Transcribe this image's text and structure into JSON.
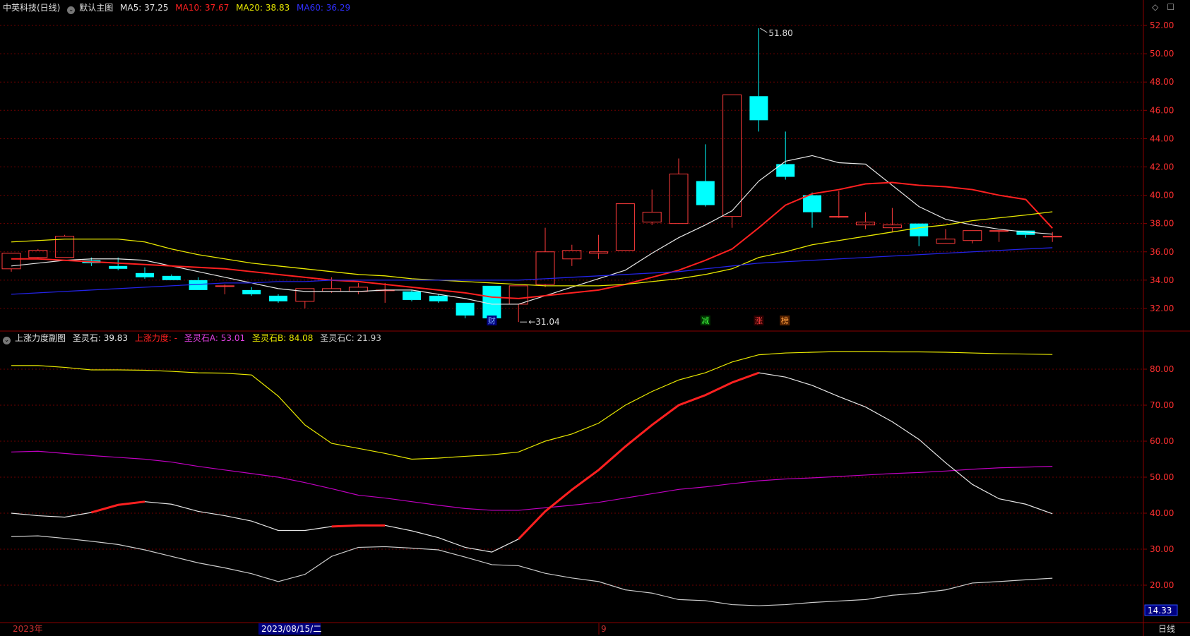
{
  "header": {
    "stock_name": "中英科技(日线)",
    "main_chart_label": "默认主图",
    "ma5": "MA5: 37.25",
    "ma10": "MA10: 37.67",
    "ma20": "MA20: 38.83",
    "ma60": "MA60: 36.29",
    "corner_icons": [
      "◇",
      "☐"
    ]
  },
  "sub_header": {
    "title": "上涨力度副图",
    "sls": "圣灵石: 39.83",
    "szld": "上涨力度: -",
    "slsa": "圣灵石A: 53.01",
    "slsb": "圣灵石B: 84.08",
    "slsc": "圣灵石C: 21.93"
  },
  "colors": {
    "up": "#ff3b3b",
    "down": "#00ffff",
    "ma5": "#e6e6e6",
    "ma10": "#ff2020",
    "ma20": "#e8e800",
    "ma60": "#2323e6",
    "grid": "#6e0000",
    "axis_text": "#ff3030",
    "purple": "#c000c0"
  },
  "time_axis": {
    "labels": [
      "2023年",
      "2023/08/15/二",
      "9"
    ],
    "period": "日线"
  },
  "markers": {
    "high": "51.80",
    "low": "31.04",
    "events": [
      "财",
      "减",
      "涨",
      "榜"
    ]
  },
  "sub_value_box": "14.33",
  "chart_data": [
    {
      "type": "candlestick",
      "title": "中英科技(日线)",
      "ylim": [
        30.5,
        52.8
      ],
      "y_ticks": [
        "32.00",
        "34.00",
        "36.00",
        "38.00",
        "40.00",
        "42.00",
        "44.00",
        "46.00",
        "48.00",
        "50.00",
        "52.00"
      ],
      "candles": [
        {
          "o": 34.8,
          "c": 35.9,
          "h": 35.9,
          "l": 34.6
        },
        {
          "o": 35.6,
          "c": 36.1,
          "h": 36.2,
          "l": 35.5
        },
        {
          "o": 35.6,
          "c": 37.1,
          "h": 37.2,
          "l": 35.6
        },
        {
          "o": 35.4,
          "c": 35.2,
          "h": 35.6,
          "l": 35.0
        },
        {
          "o": 35.0,
          "c": 34.8,
          "h": 35.6,
          "l": 34.7
        },
        {
          "o": 34.5,
          "c": 34.2,
          "h": 34.9,
          "l": 34.1
        },
        {
          "o": 34.3,
          "c": 34.0,
          "h": 34.4,
          "l": 34.0
        },
        {
          "o": 34.0,
          "c": 33.3,
          "h": 34.2,
          "l": 33.3
        },
        {
          "o": 33.6,
          "c": 33.6,
          "h": 33.7,
          "l": 33.0
        },
        {
          "o": 33.3,
          "c": 33.0,
          "h": 33.5,
          "l": 32.9
        },
        {
          "o": 32.9,
          "c": 32.5,
          "h": 33.0,
          "l": 32.4
        },
        {
          "o": 32.5,
          "c": 33.4,
          "h": 33.4,
          "l": 32.0
        },
        {
          "o": 33.2,
          "c": 33.4,
          "h": 34.2,
          "l": 33.1
        },
        {
          "o": 33.2,
          "c": 33.5,
          "h": 33.8,
          "l": 33.0
        },
        {
          "o": 33.3,
          "c": 33.3,
          "h": 33.8,
          "l": 32.4
        },
        {
          "o": 33.2,
          "c": 32.6,
          "h": 33.3,
          "l": 32.5
        },
        {
          "o": 32.9,
          "c": 32.5,
          "h": 33.0,
          "l": 32.4
        },
        {
          "o": 32.4,
          "c": 31.5,
          "h": 32.4,
          "l": 31.3
        },
        {
          "o": 33.6,
          "c": 31.3,
          "h": 33.6,
          "l": 31.2
        },
        {
          "o": 32.3,
          "c": 33.6,
          "h": 33.6,
          "l": 31.04
        },
        {
          "o": 33.7,
          "c": 36.0,
          "h": 37.7,
          "l": 33.5
        },
        {
          "o": 35.5,
          "c": 36.1,
          "h": 36.5,
          "l": 35.0
        },
        {
          "o": 35.9,
          "c": 36.0,
          "h": 37.2,
          "l": 35.5
        },
        {
          "o": 36.1,
          "c": 39.4,
          "h": 39.4,
          "l": 36.1
        },
        {
          "o": 38.1,
          "c": 38.8,
          "h": 40.4,
          "l": 37.9
        },
        {
          "o": 38.0,
          "c": 41.5,
          "h": 42.6,
          "l": 38.0
        },
        {
          "o": 41.0,
          "c": 39.3,
          "h": 43.6,
          "l": 39.2
        },
        {
          "o": 38.5,
          "c": 47.1,
          "h": 47.1,
          "l": 37.7
        },
        {
          "o": 47.0,
          "c": 45.3,
          "h": 51.8,
          "l": 44.5
        },
        {
          "o": 42.2,
          "c": 41.3,
          "h": 44.5,
          "l": 41.1
        },
        {
          "o": 40.0,
          "c": 38.8,
          "h": 40.2,
          "l": 37.7
        },
        {
          "o": 38.5,
          "c": 38.5,
          "h": 40.3,
          "l": 38.4
        },
        {
          "o": 37.9,
          "c": 38.1,
          "h": 38.8,
          "l": 37.6
        },
        {
          "o": 37.7,
          "c": 37.9,
          "h": 39.1,
          "l": 37.4
        },
        {
          "o": 38.0,
          "c": 37.1,
          "h": 38.0,
          "l": 36.4
        },
        {
          "o": 36.6,
          "c": 36.9,
          "h": 37.6,
          "l": 36.6
        },
        {
          "o": 36.8,
          "c": 37.5,
          "h": 37.5,
          "l": 36.6
        },
        {
          "o": 37.5,
          "c": 37.5,
          "h": 37.5,
          "l": 36.7
        },
        {
          "o": 37.5,
          "c": 37.2,
          "h": 37.5,
          "l": 37.0
        },
        {
          "o": 37.1,
          "c": 37.1,
          "h": 37.4,
          "l": 36.7
        }
      ],
      "series": [
        {
          "name": "MA5",
          "values": [
            35.0,
            35.2,
            35.4,
            35.5,
            35.5,
            35.4,
            35.0,
            34.6,
            34.2,
            33.8,
            33.4,
            33.2,
            33.2,
            33.2,
            33.3,
            33.3,
            33.0,
            32.7,
            32.3,
            32.3,
            32.9,
            33.5,
            34.1,
            34.7,
            35.9,
            37.0,
            37.9,
            38.9,
            41.0,
            42.4,
            42.8,
            42.3,
            42.2,
            40.7,
            39.2,
            38.3,
            37.9,
            37.6,
            37.4,
            37.25
          ]
        },
        {
          "name": "MA10",
          "values": [
            35.5,
            35.5,
            35.4,
            35.3,
            35.2,
            35.1,
            35.0,
            34.9,
            34.8,
            34.6,
            34.4,
            34.2,
            34.0,
            33.9,
            33.7,
            33.5,
            33.3,
            33.1,
            32.8,
            32.7,
            32.9,
            33.1,
            33.3,
            33.7,
            34.2,
            34.7,
            35.4,
            36.2,
            37.7,
            39.3,
            40.1,
            40.4,
            40.8,
            40.9,
            40.7,
            40.6,
            40.4,
            40.0,
            39.7,
            37.67
          ]
        },
        {
          "name": "MA20",
          "values": [
            36.7,
            36.8,
            36.9,
            36.9,
            36.9,
            36.7,
            36.2,
            35.8,
            35.5,
            35.2,
            35.0,
            34.8,
            34.6,
            34.4,
            34.3,
            34.1,
            34.0,
            33.9,
            33.8,
            33.7,
            33.6,
            33.6,
            33.6,
            33.7,
            33.9,
            34.1,
            34.4,
            34.8,
            35.6,
            36.0,
            36.5,
            36.8,
            37.1,
            37.4,
            37.7,
            37.9,
            38.2,
            38.4,
            38.6,
            38.83
          ]
        },
        {
          "name": "MA60",
          "values": [
            33.0,
            33.1,
            33.2,
            33.3,
            33.4,
            33.5,
            33.6,
            33.7,
            33.8,
            33.8,
            33.9,
            33.9,
            34.0,
            34.0,
            34.0,
            34.0,
            34.0,
            34.0,
            34.0,
            34.0,
            34.1,
            34.2,
            34.3,
            34.4,
            34.5,
            34.6,
            34.8,
            35.0,
            35.2,
            35.3,
            35.4,
            35.5,
            35.6,
            35.7,
            35.8,
            35.9,
            36.0,
            36.1,
            36.2,
            36.29
          ]
        }
      ]
    },
    {
      "type": "line",
      "title": "上涨力度副图",
      "ylim": [
        10,
        90
      ],
      "y_ticks": [
        "20.00",
        "30.00",
        "40.00",
        "50.00",
        "60.00",
        "70.00",
        "80.00"
      ],
      "series": [
        {
          "name": "圣灵石B",
          "values": [
            81,
            81,
            80.5,
            79.8,
            79.8,
            79.7,
            79.4,
            79.0,
            78.9,
            78.4,
            72.5,
            64.5,
            59.4,
            58.0,
            56.6,
            55.0,
            55.3,
            55.8,
            56.2,
            57.0,
            60.0,
            62.0,
            65.0,
            70.0,
            73.8,
            77.0,
            79.0,
            82.0,
            84.0,
            84.5,
            84.7,
            84.9,
            84.9,
            84.8,
            84.8,
            84.7,
            84.5,
            84.3,
            84.2,
            84.08
          ]
        },
        {
          "name": "圣灵石A",
          "values": [
            57.0,
            57.2,
            56.6,
            56.0,
            55.5,
            55.0,
            54.2,
            53.0,
            52.0,
            51.0,
            50.0,
            48.5,
            46.8,
            45.0,
            44.2,
            43.2,
            42.2,
            41.3,
            40.8,
            40.8,
            41.5,
            42.2,
            43.0,
            44.2,
            45.4,
            46.6,
            47.3,
            48.2,
            49.0,
            49.5,
            49.8,
            50.2,
            50.6,
            51.0,
            51.3,
            51.7,
            52.2,
            52.6,
            52.8,
            53.01
          ]
        },
        {
          "name": "圣灵石",
          "values": [
            40.0,
            39.3,
            38.9,
            40.2,
            42.3,
            43.2,
            42.5,
            40.5,
            39.3,
            37.8,
            35.2,
            35.2,
            36.3,
            36.6,
            36.6,
            35.1,
            33.2,
            30.5,
            29.2,
            32.8,
            40.5,
            46.5,
            52.0,
            58.5,
            64.5,
            70.0,
            72.8,
            76.3,
            79.0,
            77.8,
            75.5,
            72.4,
            69.5,
            65.4,
            60.5,
            54.0,
            48.0,
            44.0,
            42.5,
            39.83
          ]
        },
        {
          "name": "圣灵石C",
          "values": [
            33.5,
            33.7,
            33.0,
            32.2,
            31.3,
            29.8,
            28.0,
            26.2,
            24.8,
            23.2,
            21.0,
            23.0,
            28.0,
            30.5,
            30.7,
            30.3,
            29.8,
            27.8,
            25.7,
            25.4,
            23.3,
            22.0,
            21.0,
            18.7,
            17.8,
            16.0,
            15.7,
            14.6,
            14.3,
            14.6,
            15.2,
            15.6,
            16.0,
            17.2,
            17.8,
            18.7,
            20.6,
            21.0,
            21.5,
            21.93
          ]
        }
      ],
      "up_segments": [
        [
          3,
          5
        ],
        [
          12,
          14
        ],
        [
          19,
          28
        ]
      ]
    }
  ]
}
